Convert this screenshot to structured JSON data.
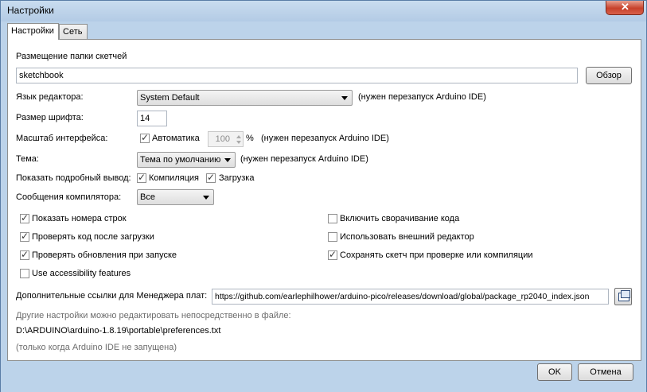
{
  "window": {
    "title": "Настройки"
  },
  "tabs": [
    {
      "label": "Настройки"
    },
    {
      "label": "Сеть"
    }
  ],
  "sketchbook": {
    "label": "Размещение папки скетчей",
    "value": "sketchbook",
    "browse": "Обзор"
  },
  "editor_language": {
    "label": "Язык редактора:",
    "value": "System Default",
    "note": "(нужен перезапуск Arduino IDE)"
  },
  "font_size": {
    "label": "Размер шрифта:",
    "value": "14"
  },
  "scale": {
    "label": "Масштаб интерфейса:",
    "auto_label": "Автоматика",
    "auto_checked": true,
    "value": "100",
    "unit": "%",
    "note": "(нужен перезапуск Arduino IDE)"
  },
  "theme": {
    "label": "Тема:",
    "value": "Тема по умолчанию",
    "note": "(нужен перезапуск Arduino IDE)"
  },
  "verbose": {
    "label": "Показать подробный вывод:",
    "compile_label": "Компиляция",
    "compile_checked": true,
    "upload_label": "Загрузка",
    "upload_checked": true
  },
  "compiler_warnings": {
    "label": "Сообщения компилятора:",
    "value": "Все"
  },
  "options_left": [
    {
      "label": "Показать номера строк",
      "checked": true
    },
    {
      "label": "Проверять код после загрузки",
      "checked": true
    },
    {
      "label": "Проверять обновления при запуске",
      "checked": true
    },
    {
      "label": "Use accessibility features",
      "checked": false
    }
  ],
  "options_right": [
    {
      "label": "Включить сворачивание кода",
      "checked": false
    },
    {
      "label": "Использовать внешний редактор",
      "checked": false
    },
    {
      "label": "Сохранять скетч при проверке или компиляции",
      "checked": true
    }
  ],
  "board_urls": {
    "label": "Дополнительные ссылки для Менеджера плат:",
    "value": "https://github.com/earlephilhower/arduino-pico/releases/download/global/package_rp2040_index.json"
  },
  "more_prefs": {
    "note": "Другие настройки можно редактировать непосредственно в файле:",
    "path": "D:\\ARDUINO\\arduino-1.8.19\\portable\\preferences.txt",
    "hint": "(только когда Arduino IDE не запущена)"
  },
  "buttons": {
    "ok": "OK",
    "cancel": "Отмена"
  }
}
